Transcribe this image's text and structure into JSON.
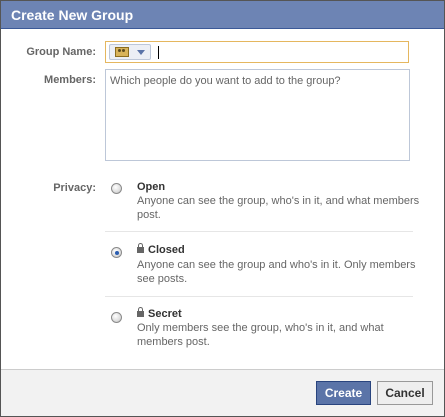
{
  "dialog": {
    "title": "Create New Group"
  },
  "form": {
    "group_name_label": "Group Name:",
    "group_name_value": "",
    "icon_selector": "person-icon",
    "members_label": "Members:",
    "members_placeholder": "Which people do you want to add to the group?",
    "privacy_label": "Privacy:"
  },
  "privacy_options": [
    {
      "title": "Open",
      "description": "Anyone can see the group, who's in it, and what members post.",
      "selected": false,
      "locked": false
    },
    {
      "title": "Closed",
      "description": "Anyone can see the group and who's in it. Only members see posts.",
      "selected": true,
      "locked": true
    },
    {
      "title": "Secret",
      "description": "Only members see the group, who's in it, and what members post.",
      "selected": false,
      "locked": true
    }
  ],
  "buttons": {
    "create_label": "Create",
    "cancel_label": "Cancel"
  },
  "colors": {
    "header_bg": "#6d84b4",
    "primary_button": "#5b74a8",
    "focus_border": "#e5b75f"
  }
}
